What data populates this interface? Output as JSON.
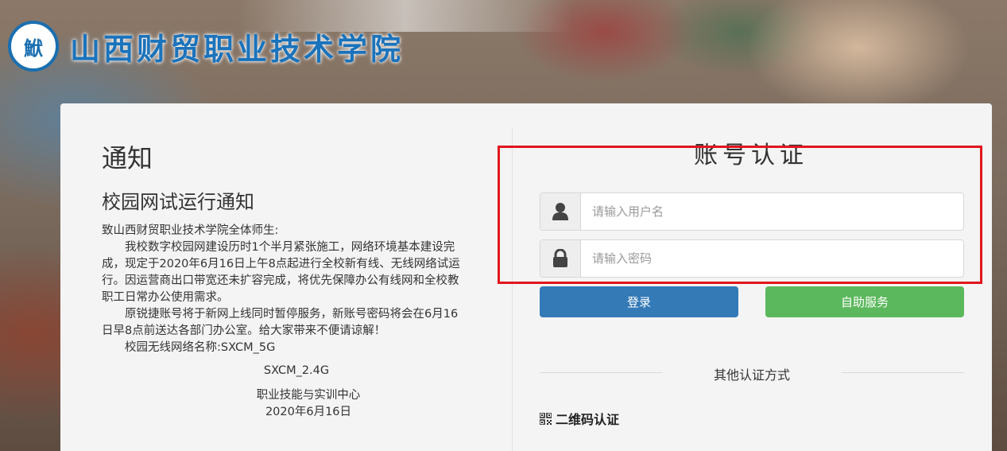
{
  "header": {
    "logo_seal_text": "鮲",
    "school_name": "山西财贸职业技术学院"
  },
  "notice": {
    "heading": "通知",
    "title": "校园网试运行通知",
    "greeting": "致山西财贸职业技术学院全体师生:",
    "para1": "我校数字校园网建设历时1个半月紧张施工，网络环境基本建设完成，现定于2020年6月16日上午8点起进行全校新有线、无线网络试运行。因运营商出口带宽还未扩容完成，将优先保障办公有线网和全校教职工日常办公使用需求。",
    "para2": "原锐捷账号将于新网上线同时暂停服务，新账号密码将会在6月16日早8点前送达各部门办公室。给大家带来不便请谅解！",
    "ssid_line": "校园无线网络名称:SXCM_5G",
    "ssid_line2": "SXCM_2.4G",
    "signature": "职业技能与实训中心",
    "date": "2020年6月16日"
  },
  "auth": {
    "title": "账号认证",
    "username_placeholder": "请输入用户名",
    "password_placeholder": "请输入密码",
    "login_label": "登录",
    "self_service_label": "自助服务",
    "other_methods_label": "其他认证方式",
    "qr_label": "二维码认证"
  },
  "colors": {
    "primary": "#337ab7",
    "success": "#5cb85c",
    "highlight": "#e0161b",
    "logo_blue": "#1b73bb"
  },
  "icons": {
    "username": "user-icon",
    "password": "lock-icon",
    "qr": "qr-code-icon"
  }
}
